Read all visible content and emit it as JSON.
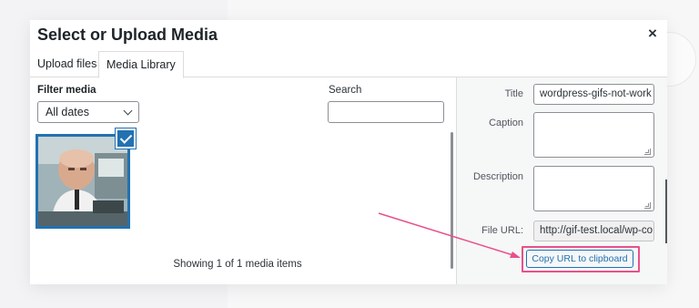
{
  "modal": {
    "title": "Select or Upload Media",
    "close_icon": "close-icon"
  },
  "tabs": [
    {
      "label": "Upload files",
      "active": false
    },
    {
      "label": "Media Library",
      "active": true
    }
  ],
  "browser": {
    "filter_label": "Filter media",
    "date_filter_value": "All dates",
    "search_label": "Search",
    "search_value": "",
    "selected_item_checked": true,
    "showing_text": "Showing 1 of 1 media items"
  },
  "details": {
    "title_label": "Title",
    "title_value": "wordpress-gifs-not-work",
    "caption_label": "Caption",
    "caption_value": "",
    "description_label": "Description",
    "description_value": "",
    "file_url_label": "File URL:",
    "file_url_value": "http://gif-test.local/wp-co",
    "copy_button_label": "Copy URL to clipboard"
  },
  "colors": {
    "accent": "#2271b1",
    "annotation": "#e8508a",
    "panel_bg": "#f6f7f7"
  }
}
